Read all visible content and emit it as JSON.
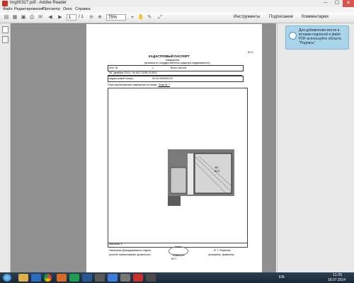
{
  "window": {
    "title": "img00327.pdf - Adobe Reader",
    "controls": {
      "minimize": "─",
      "maximize": "☐",
      "close": "✕"
    }
  },
  "menu": [
    "Файл",
    "Редактирование",
    "Просмотр",
    "Окно",
    "Справка"
  ],
  "toolbar": {
    "page_current": "1",
    "page_total": "/ 1",
    "zoom": "75%",
    "panels": [
      "Инструменты",
      "Подписание",
      "Комментарии"
    ]
  },
  "hint": {
    "text": "Для добавления места и вставки подписей в файл PDF используйте область \"Подпись\"."
  },
  "document": {
    "form_code": "КП.2",
    "title": "КАДАСТРОВЫЙ ПАСПОРТ",
    "subtitle": "помещения",
    "subtitle2": "(выписка из государственного кадастра недвижимости)",
    "sheet_label": "Лист №",
    "sheet_value": "1",
    "sheets_total_label": "Всего листов:",
    "date_line": "\"25\" декабря 2013 г. № МО-13/ЗВ-21/52/1",
    "cad_label": "Кадастровый номер:",
    "cad_value": "50:42:0000000:00",
    "plan_label": "План расположения помещения на этаже",
    "plan_value": "Этаж № 7",
    "scale_label": "Масштаб 1:",
    "footer_org": "Начальник Домодедовского отдела",
    "footer_sub": "(полное наименование должности)",
    "footer_sign": "(подпись)",
    "footer_name": "Ф. Г. Фомичев",
    "footer_name_sub": "(инициалы, фамилия)",
    "footer_mp": "М.П.",
    "room_label": "4/6",
    "room_value": "62,5"
  },
  "taskbar": {
    "lang": "EN",
    "time": "11:25",
    "date": "18.07.2014"
  }
}
